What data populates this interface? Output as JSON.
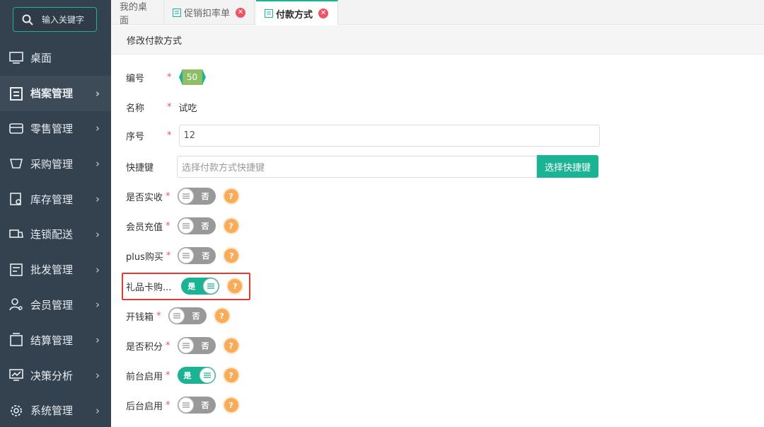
{
  "sidebar": {
    "search_label": "输入关键字",
    "items": [
      {
        "label": "桌面",
        "icon": "monitor-icon"
      },
      {
        "label": "档案管理",
        "icon": "archive-icon"
      },
      {
        "label": "零售管理",
        "icon": "store-icon"
      },
      {
        "label": "采购管理",
        "icon": "purchase-icon"
      },
      {
        "label": "库存管理",
        "icon": "inventory-icon"
      },
      {
        "label": "连锁配送",
        "icon": "truck-icon"
      },
      {
        "label": "批发管理",
        "icon": "wholesale-icon"
      },
      {
        "label": "会员管理",
        "icon": "member-icon"
      },
      {
        "label": "结算管理",
        "icon": "wallet-icon"
      },
      {
        "label": "决策分析",
        "icon": "chart-icon"
      },
      {
        "label": "系统管理",
        "icon": "gear-icon"
      }
    ]
  },
  "tabs": [
    {
      "label": "我的桌面"
    },
    {
      "label": "促销扣率单"
    },
    {
      "label": "付款方式"
    }
  ],
  "panel": {
    "title": "修改付款方式"
  },
  "form": {
    "id_label": "编号",
    "id_value": "50",
    "name_label": "名称",
    "name_value": "试吃",
    "seq_label": "序号",
    "seq_value": "12",
    "shortcut_label": "快捷键",
    "shortcut_placeholder": "选择付款方式快捷键",
    "shortcut_button": "选择快捷键",
    "star": "*",
    "toggles": [
      {
        "label": "是否实收",
        "state": "否"
      },
      {
        "label": "会员充值",
        "state": "否"
      },
      {
        "label": "plus购买",
        "state": "否"
      },
      {
        "label": "礼品卡购...",
        "state": "是"
      },
      {
        "label": "开钱箱",
        "state": "否"
      },
      {
        "label": "是否积分",
        "state": "否"
      },
      {
        "label": "前台启用",
        "state": "是"
      },
      {
        "label": "后台启用",
        "state": "否"
      }
    ],
    "help_glyph": "?"
  },
  "colors": {
    "accent": "#1ab394",
    "danger": "#ed5565",
    "warning": "#f8ac59",
    "sidebar": "#34414e"
  }
}
